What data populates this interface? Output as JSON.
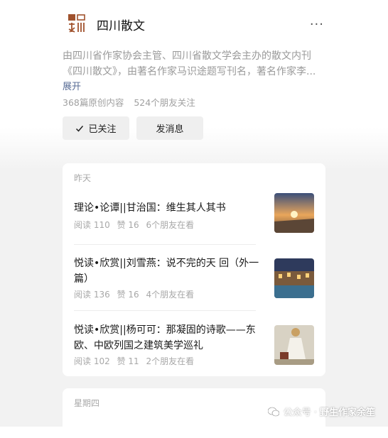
{
  "account": {
    "logo_text": "四川散文",
    "name": "四川散文",
    "more_icon": "more-dots-icon",
    "description_lines": [
      "由四川省作家协会主管、四川省散文学会主办的散文内刊",
      "《四川散文》，由著名作家马识途题写刊名，著名作家李..."
    ],
    "expand_label": "展开",
    "original_count": "368篇原创内容",
    "friends_follow": "524个朋友关注",
    "follow_label": "已关注",
    "message_label": "发消息"
  },
  "groups": [
    {
      "day": "昨天",
      "articles": [
        {
          "title": "理论•论谭||甘治国：维生其人其书",
          "reads": "阅读 110",
          "likes": "赞 16",
          "friends": "6个朋友在看"
        },
        {
          "title": "悦读•欣赏||刘雪燕：说不完的天 回（外一篇）",
          "reads": "阅读 136",
          "likes": "赞 16",
          "friends": "4个朋友在看"
        },
        {
          "title": "悦读•欣赏||杨可可：那凝固的诗歌——东欧、中欧列国之建筑美学巡礼",
          "reads": "阅读 102",
          "likes": "赞 11",
          "friends": "2个朋友在看"
        }
      ]
    },
    {
      "day": "星期四",
      "articles": []
    }
  ],
  "watermark": {
    "label": "公众号 ·",
    "name": "野生作家余笙"
  },
  "colors": {
    "link": "#576b95",
    "muted": "#a8a8a8",
    "button_bg": "#efefef",
    "page_bg": "#f2f2f2"
  }
}
